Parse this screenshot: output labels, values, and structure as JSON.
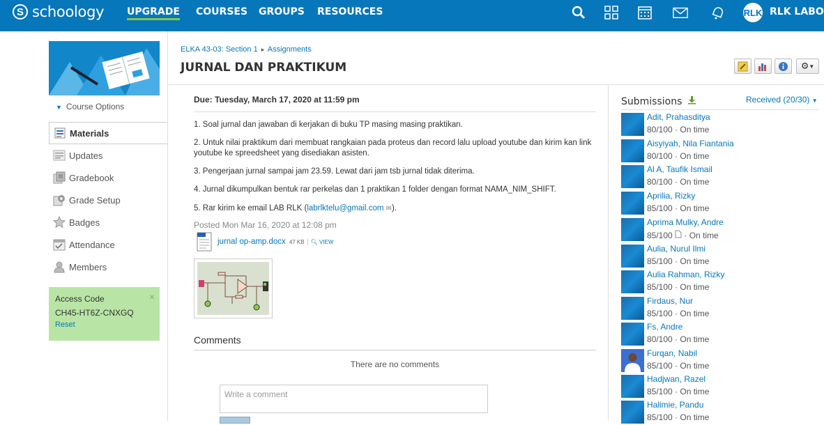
{
  "topbar": {
    "logo_text": "schoology",
    "nav": [
      "UPGRADE",
      "COURSES",
      "GROUPS",
      "RESOURCES"
    ],
    "user_initials": "RLK",
    "user_name": "RLK LABORA"
  },
  "left": {
    "course_options": "Course Options",
    "menu": [
      "Materials",
      "Updates",
      "Gradebook",
      "Grade Setup",
      "Badges",
      "Attendance",
      "Members"
    ],
    "access_code": {
      "label": "Access Code",
      "value": "CH45-HT6Z-CNXGQ",
      "reset": "Reset",
      "close": "×"
    }
  },
  "header": {
    "breadcrumb": [
      "ELKA 43-03: Section 1",
      "Assignments"
    ],
    "title": "JURNAL DAN PRAKTIKUM"
  },
  "assignment": {
    "due": "Due: Tuesday, March 17, 2020 at 11:59 pm",
    "items": [
      "1. Soal jurnal dan jawaban di kerjakan di buku TP masing masing praktikan.",
      "2. Untuk nilai praktikum dari membuat rangkaian pada proteus dan record lalu upload youtube dan kirim kan link youtube ke spreedsheet yang disediakan asisten.",
      "3. Pengerjaan jurnal sampai jam 23.59. Lewat dari jam tsb jurnal tidak diterima.",
      "4. Jurnal dikumpulkan bentuk rar perkelas dan 1 praktikan 1 folder dengan format NAMA_NIM_SHIFT."
    ],
    "item5_prefix": "5. Rar kirim ke email LAB RLK (",
    "item5_email": "labrlktelu@gmail.com",
    "item5_suffix": ").",
    "posted": "Posted Mon Mar 16, 2020 at 12:08 pm",
    "file": {
      "name": "jurnal op-amp.docx",
      "size": "47 KB",
      "view": "VIEW"
    },
    "comments_title": "Comments",
    "no_comments": "There are no comments",
    "comment_placeholder": "Write a comment"
  },
  "submissions": {
    "title": "Submissions",
    "received": "Received (20/30)",
    "list": [
      {
        "name": "Adit, Prahasditya",
        "grade": "80/100 · On time"
      },
      {
        "name": "Aisyiyah, Nila Fiantania",
        "grade": "80/100 · On time"
      },
      {
        "name": "Al A, Taufik Ismail",
        "grade": "80/100 · On time"
      },
      {
        "name": "Aprilia, Rizky",
        "grade": "85/100 · On time"
      },
      {
        "name": "Aprima Mulky, Andre",
        "grade": "85/100",
        "grade_suffix": "· On time"
      },
      {
        "name": "Aulia, Nurul Ilmi",
        "grade": "85/100 · On time"
      },
      {
        "name": "Aulia Rahman, Rizky",
        "grade": "85/100 · On time"
      },
      {
        "name": "Firdaus, Nur",
        "grade": "85/100 · On time"
      },
      {
        "name": "Fs, Andre",
        "grade": "80/100 · On time"
      },
      {
        "name": "Furqan, Nabil",
        "grade": "85/100 · On time"
      },
      {
        "name": "Hadjwan, Razel",
        "grade": "85/100 · On time"
      },
      {
        "name": "Halimie, Pandu",
        "grade": "85/100 · On time"
      }
    ]
  }
}
